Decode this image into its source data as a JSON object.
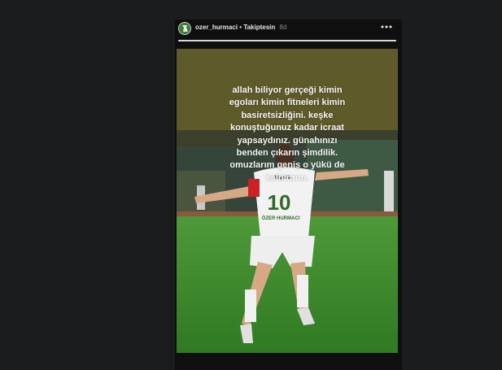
{
  "header": {
    "username": "ozer_hurmaci",
    "separator": "•",
    "follow_status": "Takiptesin",
    "age": "8d",
    "more_icon": "more-horizontal-icon"
  },
  "story": {
    "progress": 1.0,
    "caption": "allah biliyor gerçeği kimin\negoları kimin fitneleri kimin\nbasiretsizliğini. keşke\nkonuştuğunuz kadar icraat\nyapsaydınız. günahınızı\nbenden çıkarın şimdilik.\nomuzlarım geniş o yükü de\nkaldırırım.",
    "shirt_sponsor": "bigjulia",
    "shirt_number": "10",
    "shirt_name": "ÖZER HURMACI"
  },
  "colors": {
    "background": "#1b1c1e",
    "pitch": "#3f8a2c",
    "caption_band": "#5f5a2a"
  }
}
